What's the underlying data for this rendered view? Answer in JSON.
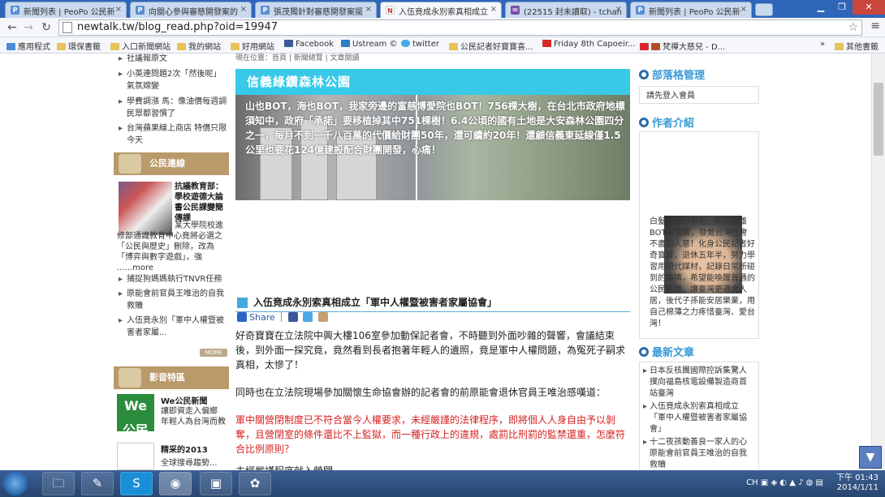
{
  "tabs": [
    {
      "label": "新聞列表 | PeoPo 公民新",
      "icon": "peopo-icon",
      "active": false
    },
    {
      "label": "向關心參與審慈開發案的",
      "icon": "peopo-icon",
      "active": false
    },
    {
      "label": "張茂獨針對審慈開發案擺",
      "icon": "peopo-icon",
      "active": false
    },
    {
      "label": "入伍竟成永別索真相成立",
      "icon": "newtalk-icon",
      "active": true
    },
    {
      "label": "(22515 封未讀取) - tchan",
      "icon": "mail-icon",
      "active": false
    },
    {
      "label": "新聞列表 | PeoPo 公民新",
      "icon": "peopo-icon",
      "active": false
    }
  ],
  "toolbar": {
    "url": "newtalk.tw/blog_read.php?oid=19947"
  },
  "bookmarks": [
    "應用程式",
    "環保書籤",
    "入口新聞網站",
    "我的網站",
    "好用網站",
    "Facebook",
    "Ustream ©",
    "twitter",
    "公民記者好寶寶喜...",
    "Friday 8th Capoeir...",
    "梵禪大慈兒 - D...",
    "»",
    "其他書籤"
  ],
  "left": {
    "top_items": [
      "社議報原文",
      "小英連問題2次「然後呢」 氣氛嫦變",
      "學費調漲 馬：像油價每週調 民眾都習慣了",
      "台灣蘋果線上商店 特價只限 今天"
    ],
    "section1_title": "公民連線",
    "feature_title": "抗議教育部：學校遊德大論書公民課變簡傳課",
    "feature_body": "某大學院校進修部通識教育中心竟將必選之「公民與歷史」刪除，改為「博弈與數字遊戲」，強 ......",
    "feature_more": "more",
    "bottom_items": [
      "捕捉狗媽媽執行TNVR任務",
      "原能會前官員王唯治的自我救贖",
      "入伍竟永別「軍中人權暨被害者家屬..."
    ],
    "more_btn": "MORE",
    "section2_title": "影音特區",
    "video1_title": "We公民新聞",
    "video1_desc": "讓即資走入偏鄉 年輕人為台灣而教",
    "video1_thumb": "We 公民新聞",
    "video2_title": "精采的2013",
    "video2_desc": "全球搜尋趨勢..."
  },
  "center": {
    "breadcrumb": "現在位置：首頁 | 新聞總覽 | 文章閱讀",
    "banner_title": "信義綠鑽森林公園",
    "banner_text": "山也BOT，海也BOT，我家旁邊的富慈博愛院也BOT！756棵大樹，在台北市政府地標須知中，政府「承諾」要移植掉其中751棵樹！6.4公頃的國有土地是大安森林公園四分之一，每月不到一千八百萬的代價給財團50年，還可續約20年！還顧信義東延線僅1.5公里也要花124億建設配合財團開發，心痛！",
    "article_title": "入伍竟成永別索真相成立「軍中人權暨被害者家屬協會」",
    "share": "Share",
    "para1": "好奇寶寶在立法院中興大樓106室參加動保記者會，不時聽到外面吵雜的聲響，會議結束後，到外面一探究竟，竟然看到長者抱著年輕人的遺照，竟是軍中人權問題，為冤死子嗣求真相，太慘了！",
    "para2": "同時也在立法院現場參加關懷生命協會辦的記者會的前原能會退休官員王唯治感嘆道：",
    "para3": "軍中關營閉制度已不符合當今人權要求，未經嚴謹的法律程序，即將個人人身自由予以剝奪，且營閉室的條件還比不上監獄，而一種行政上的違規，處罰比刑罰的監禁還重，怎麼符合比例原則？",
    "para4": "未經嚴謹程序就入營閉..."
  },
  "right": {
    "admin_title": "部落格管理",
    "admin_link": "請先登入會員",
    "author_title": "作者介紹",
    "author_bio": "白髮智智的初老，經由薦雄BOT案覺醒，發覺台灣社會不盡如人意！化身公民記者好奇寶寶，退休五年半，努力學習用現代媒材，記錄日常所碰到的事情，希望能喚醒普通的公民意識，讓臺灣更適合人居，後代子孫能安居樂業，用自己棉薄之力疼惜臺灣、愛台灣！",
    "latest_title": "最新文章",
    "latest_items": [
      "日本反核團國際控訴集驚人撲向福島核電設備製造商首站臺灣",
      "入伍竟成永別索真相成立「軍中人權暨被害者家屬協會」",
      "十二夜孩動善良一家人的心原能會前官員王唯治的自我救贖"
    ]
  },
  "taskbar": {
    "lang": "CH",
    "time": "下午 01:43",
    "date": "2014/1/11"
  }
}
